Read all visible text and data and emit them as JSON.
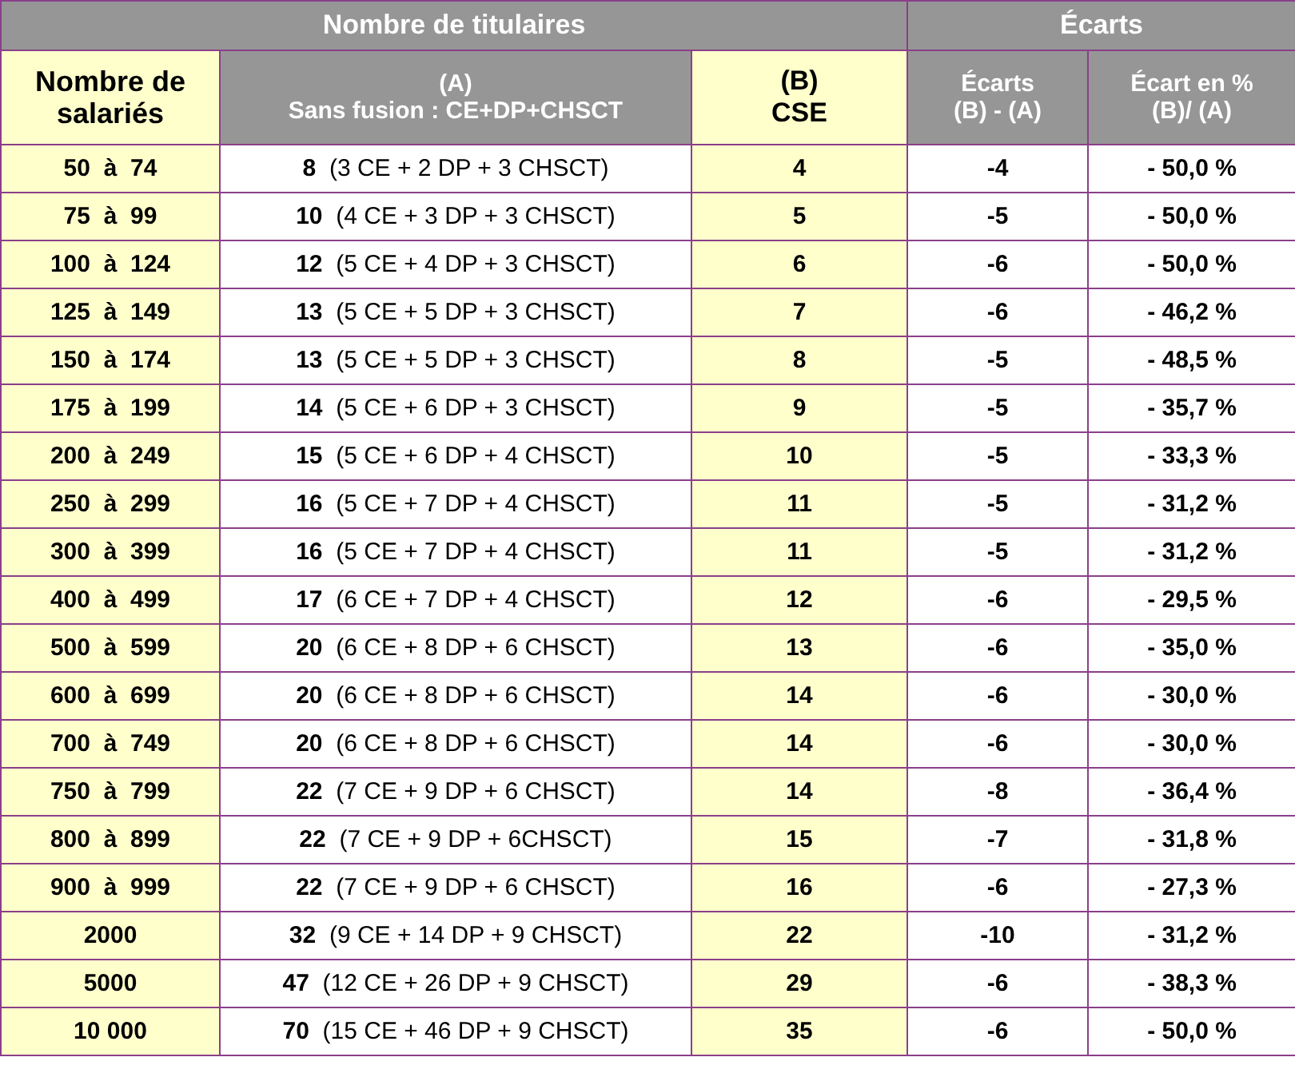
{
  "header": {
    "group_1": "Nombre de titulaires",
    "group_2": "Écarts",
    "columns": [
      {
        "kind": "yellow",
        "lines": [
          "Nombre de",
          "salariés"
        ]
      },
      {
        "kind": "gray",
        "lines": [
          "(A)",
          "Sans fusion : CE+DP+CHSCT"
        ]
      },
      {
        "kind": "yellow",
        "lines": [
          "(B)",
          "CSE"
        ]
      },
      {
        "kind": "gray",
        "lines": [
          "Écarts",
          "(B) - (A)"
        ]
      },
      {
        "kind": "gray",
        "lines": [
          "Écart en %",
          "(B)/ (A)"
        ]
      }
    ]
  },
  "rows": [
    {
      "salaries": "50  à  74",
      "a": "**8**  (3 CE + 2 DP + 3 CHSCT)",
      "b": "4",
      "ecart": "-4",
      "pct": "- 50,0 %"
    },
    {
      "salaries": "75  à  99",
      "a": "**10**  (4 CE + 3 DP + 3 CHSCT)",
      "b": "5",
      "ecart": "-5",
      "pct": "- 50,0 %"
    },
    {
      "salaries": "100  à  124",
      "a": "**12**  (5 CE + 4 DP + 3 CHSCT)",
      "b": "6",
      "ecart": "-6",
      "pct": "- 50,0 %"
    },
    {
      "salaries": "125  à  149",
      "a": "**13**  (5 CE + 5 DP + 3 CHSCT)",
      "b": "7",
      "ecart": "-6",
      "pct": "- 46,2 %"
    },
    {
      "salaries": "150  à  174",
      "a": "**13**  (5 CE + 5 DP + 3 CHSCT)",
      "b": "8",
      "ecart": "-5",
      "pct": "- 48,5 %"
    },
    {
      "salaries": "175  à  199",
      "a": "**14**  (5 CE + 6 DP + 3 CHSCT)",
      "b": "9",
      "ecart": "-5",
      "pct": "- 35,7 %"
    },
    {
      "salaries": "200  à  249",
      "a": "**15**  (5 CE + 6 DP + 4 CHSCT)",
      "b": "10",
      "ecart": "-5",
      "pct": "- 33,3 %"
    },
    {
      "salaries": "250  à  299",
      "a": "**16**  (5 CE + 7 DP + 4 CHSCT)",
      "b": "11",
      "ecart": "-5",
      "pct": "- 31,2 %"
    },
    {
      "salaries": "300  à  399",
      "a": "**16**  (5 CE + 7 DP + 4 CHSCT)",
      "b": "11",
      "ecart": "-5",
      "pct": "- 31,2 %"
    },
    {
      "salaries": "400  à  499",
      "a": "**17**  (6 CE + 7 DP + 4 CHSCT)",
      "b": "12",
      "ecart": "-6",
      "pct": "- 29,5 %"
    },
    {
      "salaries": "500  à  599",
      "a": "**20**  (6 CE + 8 DP + 6 CHSCT)",
      "b": "13",
      "ecart": "-6",
      "pct": "- 35,0 %"
    },
    {
      "salaries": "600  à  699",
      "a": "**20**  (6 CE + 8 DP + 6 CHSCT)",
      "b": "14",
      "ecart": "-6",
      "pct": "- 30,0 %"
    },
    {
      "salaries": "700  à  749",
      "a": "**20**  (6 CE + 8 DP + 6 CHSCT)",
      "b": "14",
      "ecart": "-6",
      "pct": "- 30,0 %"
    },
    {
      "salaries": "750  à  799",
      "a": "**22**  (7 CE + 9 DP + 6 CHSCT)",
      "b": "14",
      "ecart": "-8",
      "pct": "- 36,4 %"
    },
    {
      "salaries": "800  à  899",
      "a": "**22**  (7 CE + 9 DP + 6CHSCT)",
      "b": "15",
      "ecart": "-7",
      "pct": "- 31,8 %"
    },
    {
      "salaries": "900  à  999",
      "a": "**22**  (7 CE + 9 DP + 6 CHSCT)",
      "b": "16",
      "ecart": "-6",
      "pct": "- 27,3 %"
    },
    {
      "salaries": "2000",
      "a": "**32**  (9 CE + 14 DP + 9 CHSCT)",
      "b": "22",
      "ecart": "-10",
      "pct": "- 31,2 %"
    },
    {
      "salaries": "5000",
      "a": "**47**  (12 CE + 26 DP + 9 CHSCT)",
      "b": "29",
      "ecart": "-6",
      "pct": "- 38,3 %"
    },
    {
      "salaries": "10 000",
      "a": "**70**  (15 CE + 46 DP + 9 CHSCT)",
      "b": "35",
      "ecart": "-6",
      "pct": "- 50,0 %"
    }
  ]
}
